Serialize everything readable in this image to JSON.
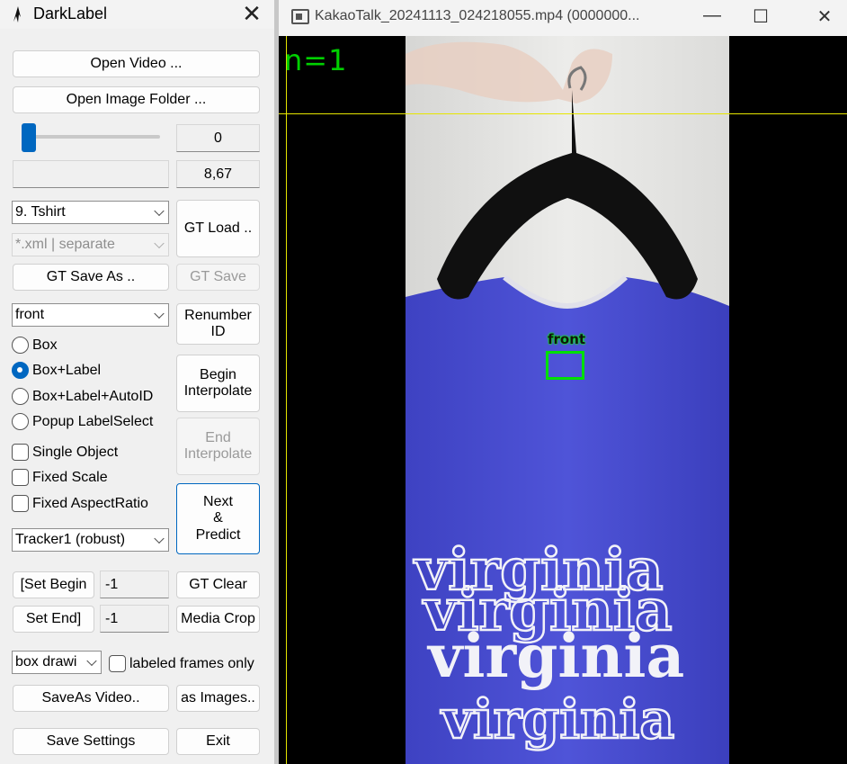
{
  "left_window": {
    "title": "DarkLabel",
    "close_glyph": "✕",
    "open_video": "Open Video ...",
    "open_image_folder": "Open Image Folder ...",
    "slider": {
      "position": 0.0
    },
    "frame_index": "0",
    "fps": "8,67",
    "info_field": "",
    "class_select": "9. Tshirt",
    "format_select": "*.xml | separate",
    "gt_load": "GT Load ..",
    "gt_save_as": "GT Save As ..",
    "gt_save": "GT Save",
    "label_select": "front",
    "renumber_id": [
      "Renumber",
      "ID"
    ],
    "radios": [
      {
        "label": "Box",
        "selected": false
      },
      {
        "label": "Box+Label",
        "selected": true
      },
      {
        "label": "Box+Label+AutoID",
        "selected": false
      },
      {
        "label": "Popup LabelSelect",
        "selected": false
      }
    ],
    "begin_interpolate": [
      "Begin",
      "Interpolate"
    ],
    "end_interpolate": [
      "End",
      "Interpolate"
    ],
    "checks": [
      {
        "label": "Single Object",
        "checked": false
      },
      {
        "label": "Fixed Scale",
        "checked": false
      },
      {
        "label": "Fixed AspectRatio",
        "checked": false
      }
    ],
    "next_predict": [
      "Next",
      "&",
      "Predict"
    ],
    "tracker_select": "Tracker1 (robust)",
    "set_begin": "[Set Begin",
    "set_begin_value": "-1",
    "set_end": "Set End]",
    "set_end_value": "-1",
    "gt_clear": "GT Clear",
    "media_crop": "Media Crop",
    "draw_select": "box drawi",
    "labeled_frames_only": "labeled frames only",
    "saveas_video": "SaveAs Video..",
    "as_images": "as Images..",
    "save_settings": "Save Settings",
    "exit": "Exit"
  },
  "video_window": {
    "title": "KakaoTalk_20241113_024218055.mp4 (0000000...",
    "minimize_glyph": "—",
    "maximize_glyph": "☐",
    "close_glyph": "✕",
    "frame_counter": "n=1",
    "box_label": "front",
    "shirt_text": [
      "virginia",
      "virginia",
      "virginia",
      "virginia"
    ],
    "colors": {
      "box": "#00e000",
      "guides": "#e6e600",
      "shirt": "#4a4ed0"
    }
  }
}
